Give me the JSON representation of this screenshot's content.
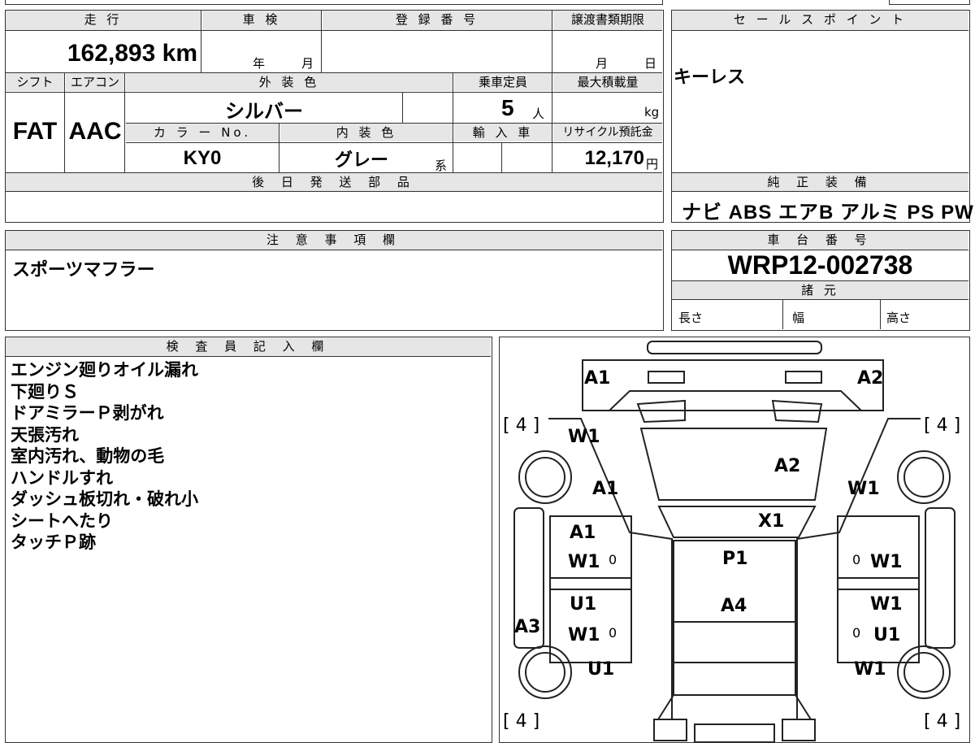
{
  "sheet": {
    "mileage_header": "走 行",
    "mileage_value": "162,893 km",
    "inspection_header": "車 検",
    "inspection_year": "年",
    "inspection_month": "月",
    "registration_header": "登 録 番 号",
    "transfer_deadline_header": "譲渡書類期限",
    "transfer_month": "月",
    "transfer_day": "日",
    "shift_header": "シフト",
    "shift_value": "FAT",
    "aircon_header": "エアコン",
    "aircon_value": "AAC",
    "exterior_color_header": "外 装 色",
    "exterior_color_value": "シルバー",
    "capacity_header": "乗車定員",
    "capacity_value": "5",
    "capacity_unit": "人",
    "max_load_header": "最大積載量",
    "max_load_unit": "kg",
    "color_no_header": "カ ラ ー No.",
    "color_no_value": "KY0",
    "interior_color_header": "内 装 色",
    "interior_color_value": "グレー",
    "interior_color_suffix": "系",
    "import_header": "輸 入 車",
    "recycle_header": "リサイクル預託金",
    "recycle_value": "12,170",
    "recycle_unit": "円",
    "later_parts_header": "後 日 発 送 部 品",
    "sales_point_header": "セ ー ル ス ポ イ ン ト",
    "sales_point_value": "キーレス",
    "genuine_equipment_header": "純 正 装 備",
    "genuine_equipment_value": "ナビ ABS エアB アルミ PS PW",
    "caution_header": "注 意 事 項 欄",
    "caution_value": "スポーツマフラー",
    "chassis_header": "車 台 番 号",
    "chassis_value": "WRP12-002738",
    "specs_header": "諸 元",
    "length_label": "長さ",
    "width_label": "幅",
    "height_label": "高さ",
    "inspector_header": "検 査 員 記 入 欄",
    "inspector_notes": [
      "エンジン廻りオイル漏れ",
      "下廻りＳ",
      "ドアミラーＰ剥がれ",
      "天張汚れ",
      "室内汚れ、動物の毛",
      "ハンドルすれ",
      "ダッシュ板切れ・破れ小",
      "シートへたり",
      "タッチＰ跡"
    ]
  },
  "diagram": {
    "labels": {
      "front_left_bumper": "A1",
      "front_right_bumper": "A2",
      "tread_fl": "[ 4 ]",
      "tread_fr": "[ 4 ]",
      "tread_rl": "[ 4 ]",
      "tread_rr": "[ 4 ]",
      "fender_left": "W1",
      "fender_left_a": "A1",
      "fender_right": "W1",
      "hood": "A2",
      "windshield": "X1",
      "front_door_left_a": "A1",
      "front_door_left_w": "W1",
      "front_door_right_w": "W1",
      "roof": "P1",
      "rear_roof": "A4",
      "rear_door_left_u": "U1",
      "rear_door_left_w": "W1",
      "rear_door_right_w": "W1",
      "rear_door_right_u": "U1",
      "side_sill_left": "A3",
      "rear_fender_left": "U1",
      "rear_fender_right": "W1",
      "glass_fl": "0",
      "glass_fr": "0",
      "glass_rl": "0",
      "glass_rr": "0"
    }
  }
}
